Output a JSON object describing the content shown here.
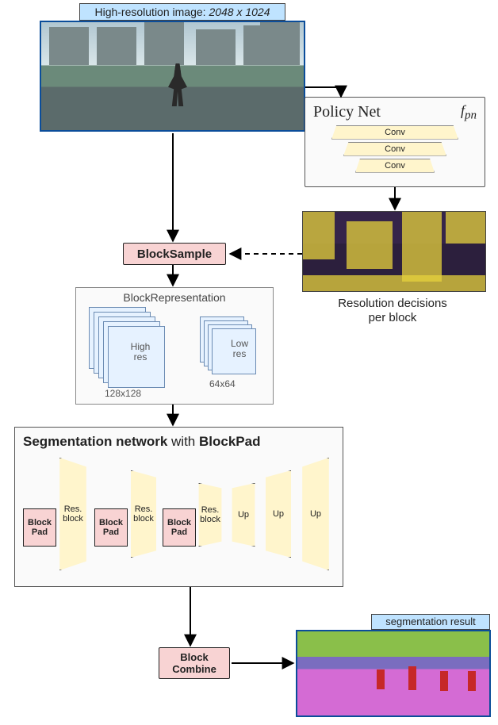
{
  "header": {
    "label_prefix": "High-resolution image: ",
    "resolution": "2048 x 1024"
  },
  "policy": {
    "title": "Policy Net",
    "fn": "f",
    "fn_sub": "pn",
    "layers": [
      "Conv",
      "Conv",
      "Conv"
    ]
  },
  "overlay": {
    "caption_l1": "Resolution decisions",
    "caption_l2": "per block"
  },
  "blocksample": {
    "label": "BlockSample"
  },
  "brep": {
    "title": "BlockRepresentation",
    "high_label": "High\nres",
    "low_label": "Low\nres",
    "high_dim": "128x128",
    "low_dim": "64x64"
  },
  "segnet": {
    "title_prefix": "Segmentation network ",
    "title_mid": "with ",
    "title_bold": "BlockPad",
    "blockpad": "Block\nPad",
    "resblock": "Res.\nblock",
    "up": "Up"
  },
  "segresult": {
    "label": "segmentation result"
  },
  "blockcombine": {
    "label_l1": "Block",
    "label_l2": "Combine"
  },
  "chart_data": {
    "type": "diagram",
    "nodes": [
      {
        "id": "input",
        "label": "High-resolution image 2048x1024"
      },
      {
        "id": "policy",
        "label": "Policy Net f_pn",
        "layers": [
          "Conv",
          "Conv",
          "Conv"
        ]
      },
      {
        "id": "decisions",
        "label": "Resolution decisions per block"
      },
      {
        "id": "blocksample",
        "label": "BlockSample"
      },
      {
        "id": "blockrep",
        "label": "BlockRepresentation",
        "outputs": [
          {
            "name": "High res",
            "size": "128x128"
          },
          {
            "name": "Low res",
            "size": "64x64"
          }
        ]
      },
      {
        "id": "segnet",
        "label": "Segmentation network with BlockPad",
        "sequence": [
          "BlockPad",
          "Res. block",
          "BlockPad",
          "Res. block",
          "BlockPad",
          "Res. block",
          "Up",
          "Up",
          "Up"
        ]
      },
      {
        "id": "blockcombine",
        "label": "BlockCombine"
      },
      {
        "id": "output",
        "label": "segmentation result"
      }
    ],
    "edges": [
      {
        "from": "input",
        "to": "policy"
      },
      {
        "from": "policy",
        "to": "decisions"
      },
      {
        "from": "input",
        "to": "blocksample"
      },
      {
        "from": "decisions",
        "to": "blocksample",
        "style": "dashed"
      },
      {
        "from": "blocksample",
        "to": "blockrep"
      },
      {
        "from": "blockrep",
        "to": "segnet"
      },
      {
        "from": "segnet",
        "to": "blockcombine"
      },
      {
        "from": "blockcombine",
        "to": "output"
      }
    ]
  }
}
